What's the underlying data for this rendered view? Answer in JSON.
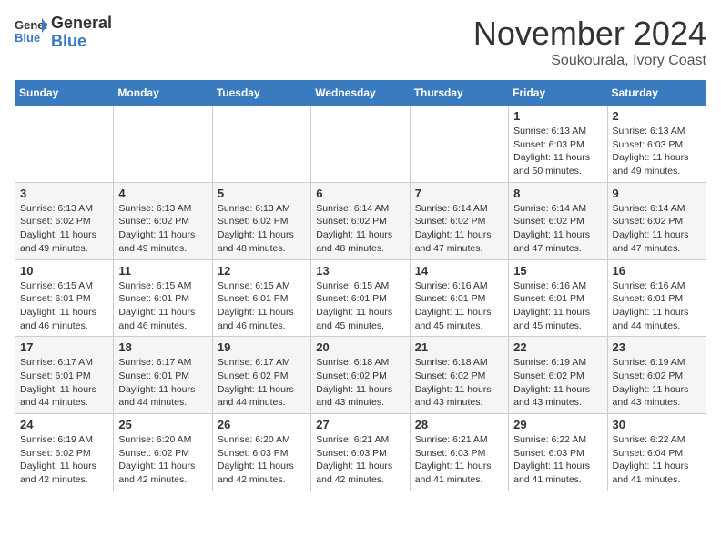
{
  "header": {
    "logo_general": "General",
    "logo_blue": "Blue",
    "month_title": "November 2024",
    "location": "Soukourala, Ivory Coast"
  },
  "weekdays": [
    "Sunday",
    "Monday",
    "Tuesday",
    "Wednesday",
    "Thursday",
    "Friday",
    "Saturday"
  ],
  "weeks": [
    [
      {
        "day": "",
        "info": ""
      },
      {
        "day": "",
        "info": ""
      },
      {
        "day": "",
        "info": ""
      },
      {
        "day": "",
        "info": ""
      },
      {
        "day": "",
        "info": ""
      },
      {
        "day": "1",
        "info": "Sunrise: 6:13 AM\nSunset: 6:03 PM\nDaylight: 11 hours\nand 50 minutes."
      },
      {
        "day": "2",
        "info": "Sunrise: 6:13 AM\nSunset: 6:03 PM\nDaylight: 11 hours\nand 49 minutes."
      }
    ],
    [
      {
        "day": "3",
        "info": "Sunrise: 6:13 AM\nSunset: 6:02 PM\nDaylight: 11 hours\nand 49 minutes."
      },
      {
        "day": "4",
        "info": "Sunrise: 6:13 AM\nSunset: 6:02 PM\nDaylight: 11 hours\nand 49 minutes."
      },
      {
        "day": "5",
        "info": "Sunrise: 6:13 AM\nSunset: 6:02 PM\nDaylight: 11 hours\nand 48 minutes."
      },
      {
        "day": "6",
        "info": "Sunrise: 6:14 AM\nSunset: 6:02 PM\nDaylight: 11 hours\nand 48 minutes."
      },
      {
        "day": "7",
        "info": "Sunrise: 6:14 AM\nSunset: 6:02 PM\nDaylight: 11 hours\nand 47 minutes."
      },
      {
        "day": "8",
        "info": "Sunrise: 6:14 AM\nSunset: 6:02 PM\nDaylight: 11 hours\nand 47 minutes."
      },
      {
        "day": "9",
        "info": "Sunrise: 6:14 AM\nSunset: 6:02 PM\nDaylight: 11 hours\nand 47 minutes."
      }
    ],
    [
      {
        "day": "10",
        "info": "Sunrise: 6:15 AM\nSunset: 6:01 PM\nDaylight: 11 hours\nand 46 minutes."
      },
      {
        "day": "11",
        "info": "Sunrise: 6:15 AM\nSunset: 6:01 PM\nDaylight: 11 hours\nand 46 minutes."
      },
      {
        "day": "12",
        "info": "Sunrise: 6:15 AM\nSunset: 6:01 PM\nDaylight: 11 hours\nand 46 minutes."
      },
      {
        "day": "13",
        "info": "Sunrise: 6:15 AM\nSunset: 6:01 PM\nDaylight: 11 hours\nand 45 minutes."
      },
      {
        "day": "14",
        "info": "Sunrise: 6:16 AM\nSunset: 6:01 PM\nDaylight: 11 hours\nand 45 minutes."
      },
      {
        "day": "15",
        "info": "Sunrise: 6:16 AM\nSunset: 6:01 PM\nDaylight: 11 hours\nand 45 minutes."
      },
      {
        "day": "16",
        "info": "Sunrise: 6:16 AM\nSunset: 6:01 PM\nDaylight: 11 hours\nand 44 minutes."
      }
    ],
    [
      {
        "day": "17",
        "info": "Sunrise: 6:17 AM\nSunset: 6:01 PM\nDaylight: 11 hours\nand 44 minutes."
      },
      {
        "day": "18",
        "info": "Sunrise: 6:17 AM\nSunset: 6:01 PM\nDaylight: 11 hours\nand 44 minutes."
      },
      {
        "day": "19",
        "info": "Sunrise: 6:17 AM\nSunset: 6:02 PM\nDaylight: 11 hours\nand 44 minutes."
      },
      {
        "day": "20",
        "info": "Sunrise: 6:18 AM\nSunset: 6:02 PM\nDaylight: 11 hours\nand 43 minutes."
      },
      {
        "day": "21",
        "info": "Sunrise: 6:18 AM\nSunset: 6:02 PM\nDaylight: 11 hours\nand 43 minutes."
      },
      {
        "day": "22",
        "info": "Sunrise: 6:19 AM\nSunset: 6:02 PM\nDaylight: 11 hours\nand 43 minutes."
      },
      {
        "day": "23",
        "info": "Sunrise: 6:19 AM\nSunset: 6:02 PM\nDaylight: 11 hours\nand 43 minutes."
      }
    ],
    [
      {
        "day": "24",
        "info": "Sunrise: 6:19 AM\nSunset: 6:02 PM\nDaylight: 11 hours\nand 42 minutes."
      },
      {
        "day": "25",
        "info": "Sunrise: 6:20 AM\nSunset: 6:02 PM\nDaylight: 11 hours\nand 42 minutes."
      },
      {
        "day": "26",
        "info": "Sunrise: 6:20 AM\nSunset: 6:03 PM\nDaylight: 11 hours\nand 42 minutes."
      },
      {
        "day": "27",
        "info": "Sunrise: 6:21 AM\nSunset: 6:03 PM\nDaylight: 11 hours\nand 42 minutes."
      },
      {
        "day": "28",
        "info": "Sunrise: 6:21 AM\nSunset: 6:03 PM\nDaylight: 11 hours\nand 41 minutes."
      },
      {
        "day": "29",
        "info": "Sunrise: 6:22 AM\nSunset: 6:03 PM\nDaylight: 11 hours\nand 41 minutes."
      },
      {
        "day": "30",
        "info": "Sunrise: 6:22 AM\nSunset: 6:04 PM\nDaylight: 11 hours\nand 41 minutes."
      }
    ]
  ]
}
